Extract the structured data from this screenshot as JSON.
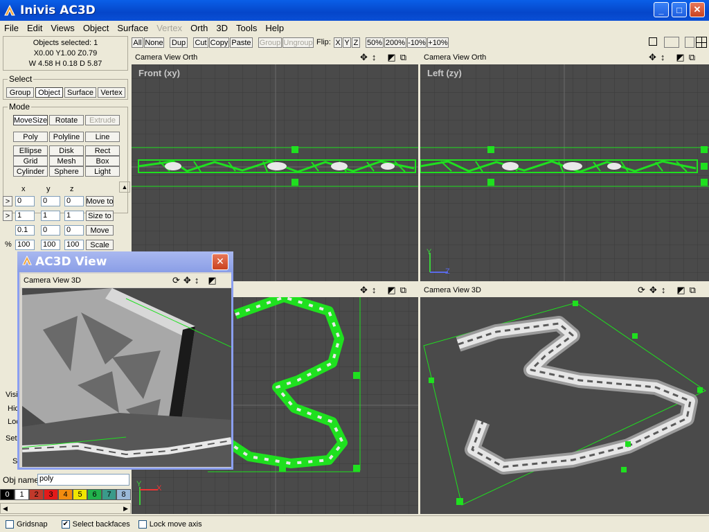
{
  "window": {
    "title": "Inivis AC3D"
  },
  "menu": [
    "File",
    "Edit",
    "Views",
    "Object",
    "Surface",
    "Vertex",
    "Orth",
    "3D",
    "Tools",
    "Help"
  ],
  "menu_disabled": [
    "Vertex"
  ],
  "info": {
    "line1": "Objects selected: 1",
    "line2": "X0.00 Y1.00 Z0.79",
    "line3": "W 4.58 H 0.18 D 5.87"
  },
  "select": {
    "label": "Select",
    "buttons": [
      "Group",
      "Object",
      "Surface",
      "Vertex"
    ],
    "active": "Object"
  },
  "mode": {
    "label": "Mode",
    "row1": [
      "MoveSize",
      "Rotate",
      "Extrude"
    ],
    "shapes": [
      "Poly",
      "Polyline",
      "Line",
      "Ellipse",
      "Disk",
      "Rect",
      "Grid",
      "Mesh",
      "Box",
      "Cylinder",
      "Sphere",
      "Light"
    ]
  },
  "xyz": {
    "headers": [
      "x",
      "y",
      "z"
    ],
    "rows": [
      {
        "prefix": ">",
        "x": "0",
        "y": "0",
        "z": "0",
        "action": "Move to"
      },
      {
        "prefix": ">",
        "x": "1",
        "y": "1",
        "z": "1",
        "action": "Size to"
      },
      {
        "prefix": "",
        "x": "0.1",
        "y": "0",
        "z": "0",
        "action": "Move"
      },
      {
        "prefix": "%",
        "x": "100",
        "y": "100",
        "z": "100",
        "action": "Scale"
      }
    ]
  },
  "side_partial": {
    "visible": "Visi",
    "hide": "Hid",
    "lock": "Loc",
    "set": "Set",
    "s": "S"
  },
  "objname": {
    "label": "Obj name:",
    "value": "poly"
  },
  "palette": [
    {
      "n": "0",
      "c": "#000000"
    },
    {
      "n": "1",
      "c": "#ffffff"
    },
    {
      "n": "2",
      "c": "#c0392b"
    },
    {
      "n": "3",
      "c": "#e31a1a"
    },
    {
      "n": "4",
      "c": "#f28c0f"
    },
    {
      "n": "5",
      "c": "#f0e600"
    },
    {
      "n": "6",
      "c": "#22b14c"
    },
    {
      "n": "7",
      "c": "#3a9a8a"
    },
    {
      "n": "8",
      "c": "#9ab8d8"
    }
  ],
  "toolbar": {
    "buttons": [
      "All",
      "None",
      "Dup",
      "Cut",
      "Copy",
      "Paste",
      "Group",
      "Ungroup"
    ],
    "disabled": [
      "Group",
      "Ungroup"
    ],
    "flip": "Flip:",
    "flipaxes": [
      "X",
      "Y",
      "Z"
    ],
    "zoom": [
      "50%",
      "200%",
      "-10%",
      "+10%"
    ]
  },
  "viewports": {
    "front": {
      "header": "Camera  View  Orth",
      "label": "Front (xy)"
    },
    "left": {
      "header": "Camera  View  Orth",
      "label": "Left (zy)"
    },
    "top": {
      "header": "",
      "label": ""
    },
    "persp": {
      "header": "Camera  View  3D"
    }
  },
  "floating": {
    "title": "AC3D View",
    "header": "Camera  View  3D"
  },
  "axes": {
    "y": "Y",
    "z": "Z",
    "x": "X"
  },
  "status": {
    "gridsnap": "Gridsnap",
    "backfaces": "Select backfaces",
    "lockaxis": "Lock move axis",
    "gridsnap_on": false,
    "backfaces_on": true,
    "lockaxis_on": false
  },
  "colors": {
    "wire": "#1fe01f",
    "viewport_bg": "#4a4a4a",
    "model": "#c8c8c8"
  }
}
